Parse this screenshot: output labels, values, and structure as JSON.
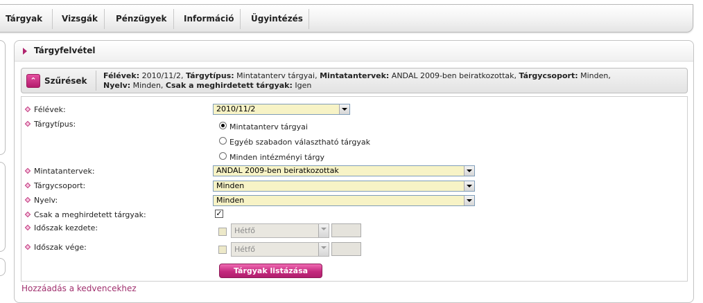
{
  "nav": {
    "items": [
      "Tárgyak",
      "Vizsgák",
      "Pénzügyek",
      "Információ",
      "Ügyintézés"
    ]
  },
  "panel": {
    "title": "Tárgyfelvétel"
  },
  "filters": {
    "label": "Szűrések",
    "summary": [
      {
        "key": "Félévek:",
        "value": " 2010/11/2, "
      },
      {
        "key": "Tárgytípus:",
        "value": " Mintatanterv tárgyai, "
      },
      {
        "key": "Mintatantervek:",
        "value": " ANDAL 2009-ben beiratkozottak, "
      },
      {
        "key": "Tárgycsoport:",
        "value": " Minden, "
      },
      {
        "key": "Nyelv:",
        "value": " Minden, "
      },
      {
        "key": "Csak a meghirdetett tárgyak:",
        "value": " Igen"
      }
    ]
  },
  "form": {
    "semesters_label": "Félévek:",
    "semesters_value": "2010/11/2",
    "subject_type_label": "Tárgytípus:",
    "subject_type_options": [
      {
        "label": "Mintatanterv tárgyai",
        "checked": true
      },
      {
        "label": "Egyéb szabadon választható tárgyak",
        "checked": false
      },
      {
        "label": "Minden intézményi tárgy",
        "checked": false
      }
    ],
    "curricula_label": "Mintatantervek:",
    "curricula_value": "ANDAL 2009-ben beiratkozottak",
    "subject_group_label": "Tárgycsoport:",
    "subject_group_value": "Minden",
    "language_label": "Nyelv:",
    "language_value": "Minden",
    "announced_only_label": "Csak a meghirdetett tárgyak:",
    "announced_only_checked": true,
    "period_start_label": "Időszak kezdete:",
    "period_start_day": "Hétfő",
    "period_end_label": "Időszak vége:",
    "period_end_day": "Hétfő",
    "submit_label": "Tárgyak listázása"
  },
  "footer": {
    "favorites_link": "Hozzáadás a kedvencekhez"
  },
  "colors": {
    "accent": "#b0246e",
    "select_bg": "#f7f3c6"
  }
}
